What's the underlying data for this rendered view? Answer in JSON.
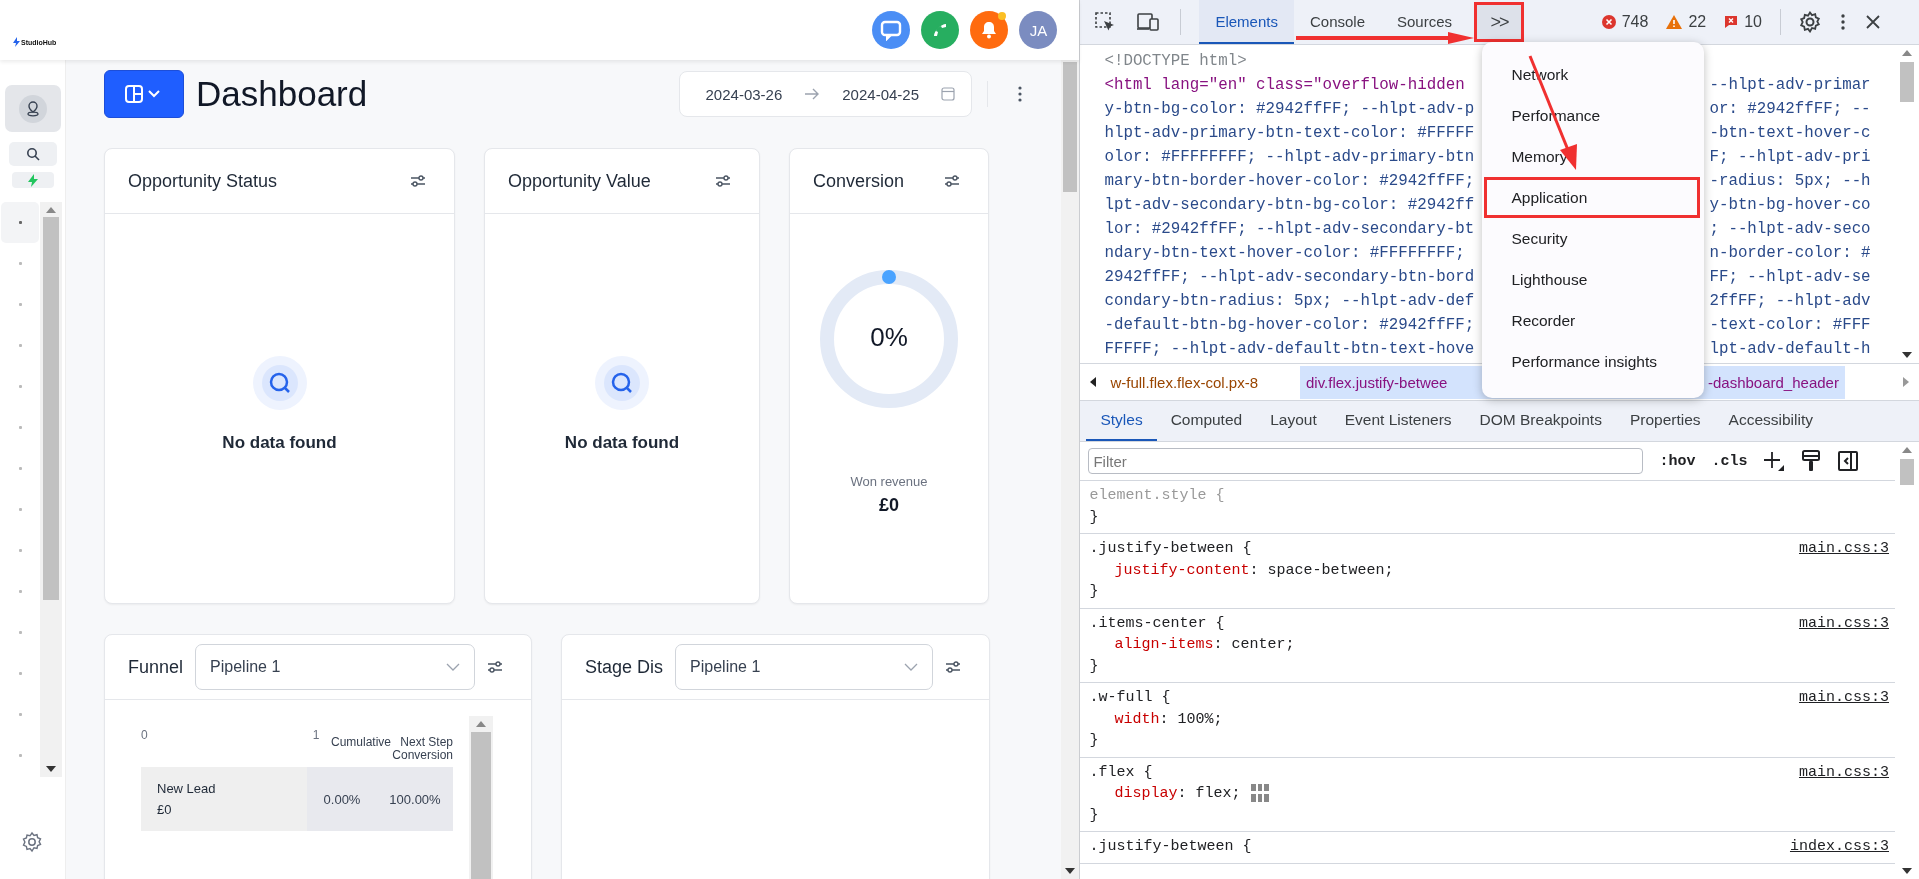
{
  "app": {
    "logo": "StudioHub",
    "notifications": {
      "unread": true
    },
    "avatar": {
      "initials": "JA"
    }
  },
  "dashboard": {
    "title": "Dashboard",
    "date_range": {
      "start": "2024-03-26",
      "end": "2024-04-25"
    }
  },
  "widgets": [
    {
      "kind": "empty",
      "title": "Opportunity Status",
      "message": "No data found"
    },
    {
      "kind": "empty",
      "title": "Opportunity Value",
      "message": "No data found"
    },
    {
      "kind": "gauge",
      "title": "Conversion",
      "value": "0%",
      "caption": "Won revenue",
      "amount": "£0"
    }
  ],
  "lower_widgets": [
    {
      "kind": "funnel",
      "title": "Funnel",
      "pipeline": "Pipeline 1",
      "axis_ticks": [
        "0",
        "1"
      ],
      "columns": [
        "Cumulative",
        "Next Step Conversion"
      ],
      "rows": [
        {
          "stage": "New Lead",
          "amount": "£0",
          "cumulative": "0.00%",
          "next_step": "100.00%"
        }
      ]
    },
    {
      "kind": "blank",
      "title": "Stage Dis",
      "pipeline": "Pipeline 1"
    }
  ],
  "devtools": {
    "tabs": [
      {
        "label": "Elements",
        "selected": true
      },
      {
        "label": "Console",
        "selected": false
      },
      {
        "label": "Sources",
        "selected": false
      }
    ],
    "more_button": {
      "label": ">>",
      "annotated": true
    },
    "counts": {
      "errors": "748",
      "warnings": "22",
      "issues": "10"
    },
    "code_lines": [
      {
        "kind": "doctype",
        "left": "<!DOCTYPE html>"
      },
      {
        "kind": "tag",
        "left": "<html lang=\"en\" class=\"overflow-hidden",
        "right": "--hlpt-adv-primar"
      },
      {
        "kind": "value",
        "left": "y-btn-bg-color: #2942ffFF; --hlpt-adv-p",
        "right": "or: #2942ffFF; --"
      },
      {
        "kind": "value",
        "left": "hlpt-adv-primary-btn-text-color: #FFFFF",
        "right": "-btn-text-hover-c"
      },
      {
        "kind": "value",
        "left": "olor: #FFFFFFFF; --hlpt-adv-primary-btn",
        "right": "F; --hlpt-adv-pri"
      },
      {
        "kind": "value",
        "left": "mary-btn-border-hover-color: #2942ffFF;",
        "right": "-radius: 5px; --h"
      },
      {
        "kind": "value",
        "left": "lpt-adv-secondary-btn-bg-color: #2942ff",
        "right": "y-btn-bg-hover-co"
      },
      {
        "kind": "value",
        "left": "lor: #2942ffFF; --hlpt-adv-secondary-bt",
        "right": "; --hlpt-adv-seco"
      },
      {
        "kind": "value",
        "left": "ndary-btn-text-hover-color: #FFFFFFFF;",
        "right": "n-border-color: #"
      },
      {
        "kind": "value",
        "left": "2942ffFF; --hlpt-adv-secondary-btn-bord",
        "right": "FF; --hlpt-adv-se"
      },
      {
        "kind": "value",
        "left": "condary-btn-radius: 5px; --hlpt-adv-def",
        "right": "2ffFF; --hlpt-adv"
      },
      {
        "kind": "value",
        "left": "-default-btn-bg-hover-color: #2942ffFF;",
        "right": "-text-color: #FFF"
      },
      {
        "kind": "value",
        "left": "FFFFF; --hlpt-adv-default-btn-text-hove",
        "right": "lpt-adv-default-h"
      }
    ],
    "breadcrumbs": [
      {
        "text": "w-full.flex.flex-col.px-8",
        "selected": false
      },
      {
        "text": "div.flex.justify-betwee",
        "selected": true
      },
      {
        "text": "-dashboard_header",
        "selected": true
      }
    ],
    "menu": [
      {
        "label": "Network",
        "annotated": false
      },
      {
        "label": "Performance",
        "annotated": false
      },
      {
        "label": "Memory",
        "annotated": false
      },
      {
        "label": "Application",
        "annotated": true
      },
      {
        "label": "Security",
        "annotated": false
      },
      {
        "label": "Lighthouse",
        "annotated": false
      },
      {
        "label": "Recorder",
        "annotated": false
      },
      {
        "label": "Performance insights",
        "annotated": false
      }
    ],
    "pane_tabs": [
      {
        "label": "Styles",
        "selected": true
      },
      {
        "label": "Computed",
        "selected": false
      },
      {
        "label": "Layout",
        "selected": false
      },
      {
        "label": "Event Listeners",
        "selected": false
      },
      {
        "label": "DOM Breakpoints",
        "selected": false
      },
      {
        "label": "Properties",
        "selected": false
      },
      {
        "label": "Accessibility",
        "selected": false
      }
    ],
    "filter": {
      "placeholder": "Filter"
    },
    "toggles": [
      ":hov",
      ".cls"
    ],
    "rules": [
      {
        "kind": "inline",
        "selector": "element.style {",
        "close": "}"
      },
      {
        "kind": "class",
        "selector": ".justify-between {",
        "source": "main.css:3",
        "close": "}",
        "declarations": [
          {
            "property": "justify-content",
            "value": ": space-between;",
            "editor": false
          }
        ]
      },
      {
        "kind": "class",
        "selector": ".items-center {",
        "source": "main.css:3",
        "close": "}",
        "declarations": [
          {
            "property": "align-items",
            "value": ": center;",
            "editor": false
          }
        ]
      },
      {
        "kind": "class",
        "selector": ".w-full {",
        "source": "main.css:3",
        "close": "}",
        "declarations": [
          {
            "property": "width",
            "value": ": 100%;",
            "editor": false
          }
        ]
      },
      {
        "kind": "class",
        "selector": ".flex {",
        "source": "main.css:3",
        "close": "}",
        "declarations": [
          {
            "property": "display",
            "value": ": flex;",
            "editor": true
          }
        ]
      },
      {
        "kind": "class",
        "selector": ".justify-between {",
        "source": "index.css:3"
      }
    ]
  }
}
